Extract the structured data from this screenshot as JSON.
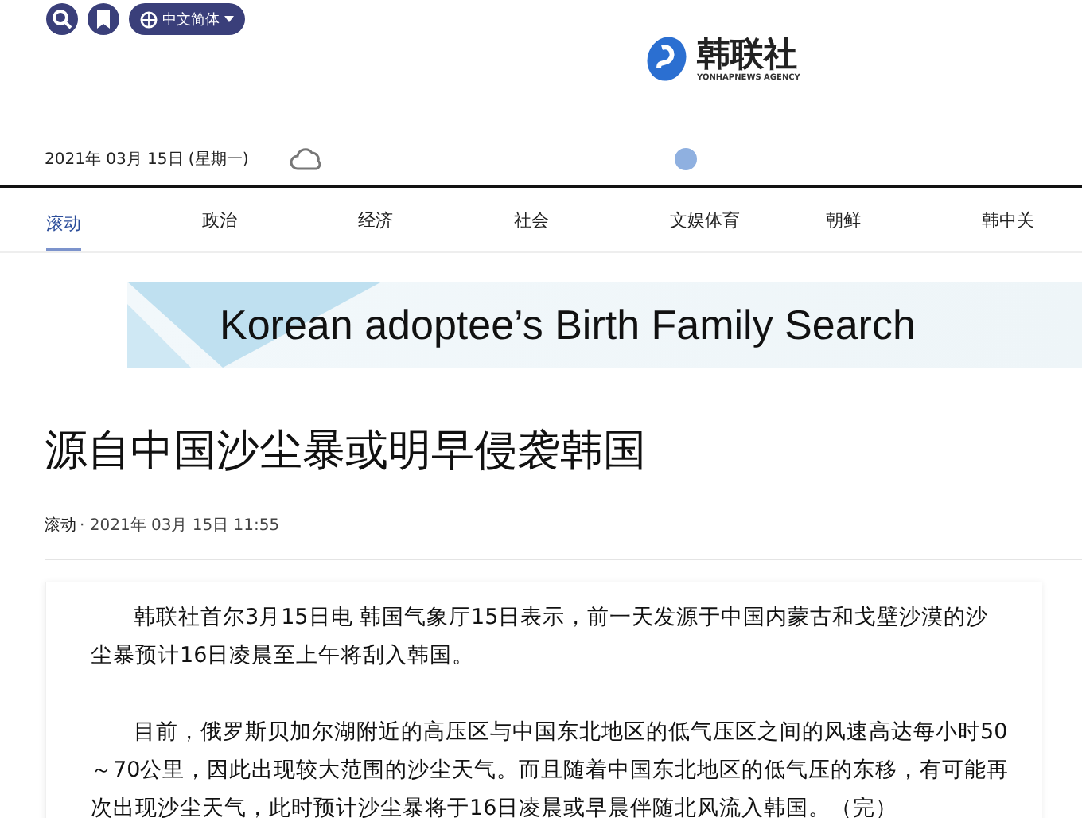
{
  "top_bar": {
    "language": "中文简体"
  },
  "logo": {
    "name": "韩联社",
    "tagline": "YONHAPNEWS AGENCY"
  },
  "date": "2021年 03月 15日 (星期一)",
  "nav": [
    {
      "label": "滚动",
      "selected": true
    },
    {
      "label": "政治",
      "selected": false
    },
    {
      "label": "经济",
      "selected": false
    },
    {
      "label": "社会",
      "selected": false
    },
    {
      "label": "文娱体育",
      "selected": false
    },
    {
      "label": "朝鲜",
      "selected": false
    },
    {
      "label": "韩中关",
      "selected": false
    }
  ],
  "banner": {
    "text": "Korean adoptee’s Birth Family Search"
  },
  "article": {
    "title": "源自中国沙尘暴或明早侵袭韩国",
    "category": "滚动",
    "dateline": "· 2021年 03月 15日 11:55",
    "paragraphs": [
      "韩联社首尔3月15日电 韩国气象厅15日表示，前一天发源于中国内蒙古和戈壁沙漠的沙尘暴预计16日凌晨至上午将刮入韩国。",
      "目前，俄罗斯贝加尔湖附近的高压区与中国东北地区的低气压区之间的风速高达每小时50～70公里，因此出现较大范围的沙尘天气。而且随着中国东北地区的低气压的东移，有可能再次出现沙尘天气，此时预计沙尘暴将于16日凌晨或早晨伴随北风流入韩国。（完）"
    ]
  }
}
